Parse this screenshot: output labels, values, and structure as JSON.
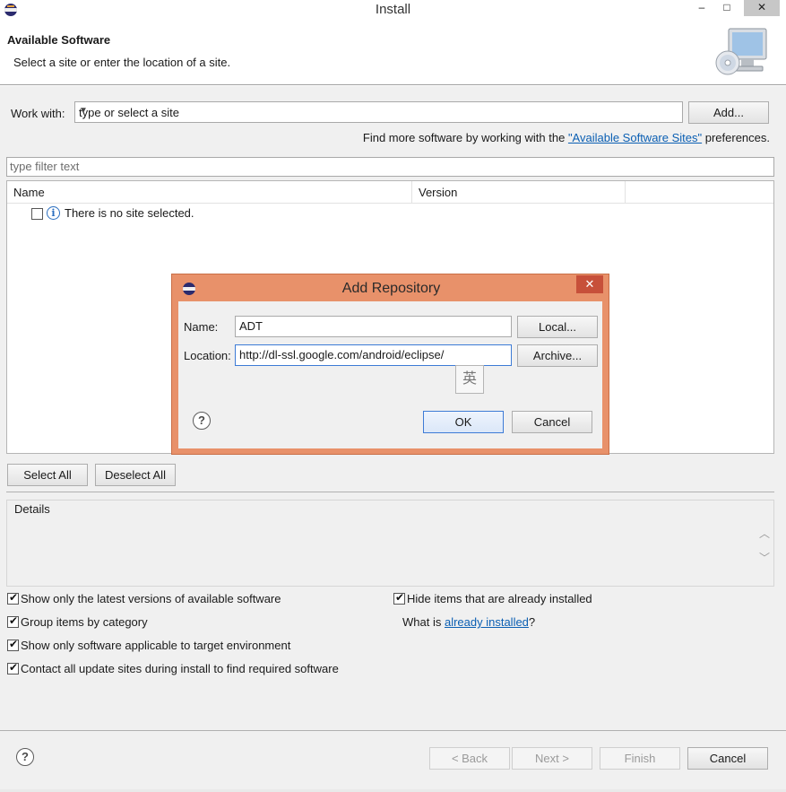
{
  "window": {
    "title": "Install",
    "minimize": "–",
    "maximize": "□",
    "close": "✕"
  },
  "header": {
    "title": "Available Software",
    "subtitle": "Select a site or enter the location of a site."
  },
  "work_with": {
    "label": "Work with:",
    "value": "type or select a site",
    "add_button": "Add...",
    "more_prefix": "Find more software by working with the ",
    "more_link": "\"Available Software Sites\"",
    "more_suffix": " preferences."
  },
  "filter": {
    "placeholder": "type filter text"
  },
  "tree": {
    "columns": [
      "Name",
      "Version"
    ],
    "empty_message": "There is no site selected."
  },
  "selection_buttons": {
    "select_all": "Select All",
    "deselect_all": "Deselect All"
  },
  "details": {
    "label": "Details"
  },
  "options": {
    "left": [
      {
        "label": "Show only the latest versions of available software",
        "checked": true
      },
      {
        "label": "Group items by category",
        "checked": true
      },
      {
        "label": "Show only software applicable to target environment",
        "checked": true
      },
      {
        "label": "Contact all update sites during install to find required software",
        "checked": true
      }
    ],
    "right": {
      "hide_installed": {
        "label": "Hide items that are already installed",
        "checked": true
      },
      "what_is_prefix": "What is ",
      "what_is_link": "already installed",
      "what_is_suffix": "?"
    }
  },
  "footer": {
    "help": "?",
    "back": "< Back",
    "next": "Next >",
    "finish": "Finish",
    "cancel": "Cancel"
  },
  "dialog": {
    "title": "Add Repository",
    "close": "✕",
    "name_label": "Name:",
    "name_value": "ADT",
    "location_label": "Location:",
    "location_value": "http://dl-ssl.google.com/android/eclipse/",
    "local_button": "Local...",
    "archive_button": "Archive...",
    "ime_char": "英",
    "help": "?",
    "ok": "OK",
    "cancel": "Cancel"
  }
}
